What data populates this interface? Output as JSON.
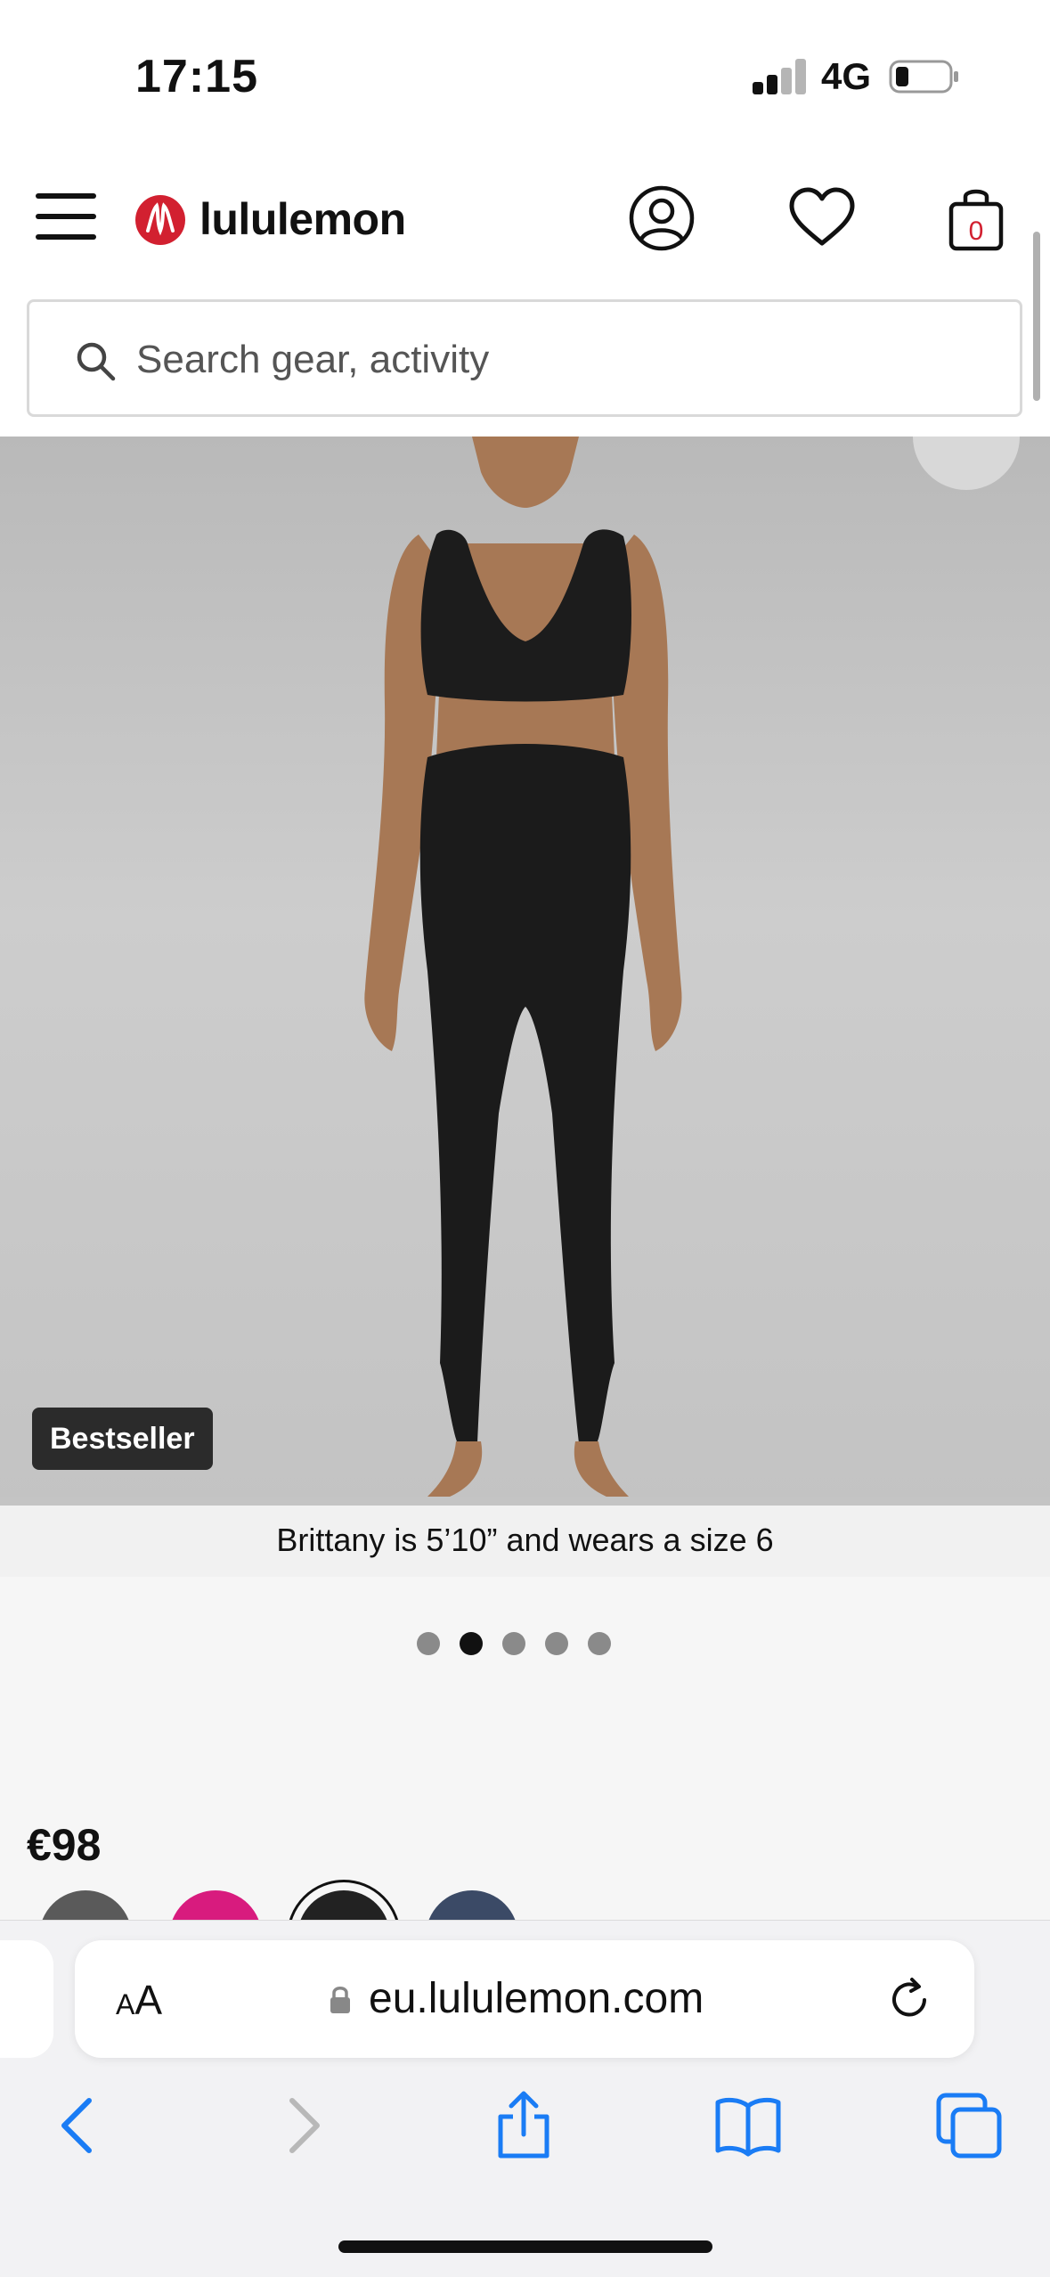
{
  "status_bar": {
    "time": "17:15",
    "network": "4G"
  },
  "header": {
    "brand": "lululemon",
    "cart_count": "0"
  },
  "search": {
    "placeholder": "Search gear, activity"
  },
  "product": {
    "badge": "Bestseller",
    "model_caption": "Brittany is 5’10” and wears a size 6",
    "image_count": 5,
    "active_image": 2,
    "price": "€98",
    "swatch_colors": [
      "#5a5a5a",
      "#d81b7e",
      "#222222",
      "#3b4a66"
    ],
    "selected_swatch": 3
  },
  "browser": {
    "text_size_label_small": "A",
    "text_size_label_large": "A",
    "url": "eu.lululemon.com"
  },
  "colors": {
    "brand_red": "#d22030",
    "safari_blue": "#1a7cf5"
  }
}
